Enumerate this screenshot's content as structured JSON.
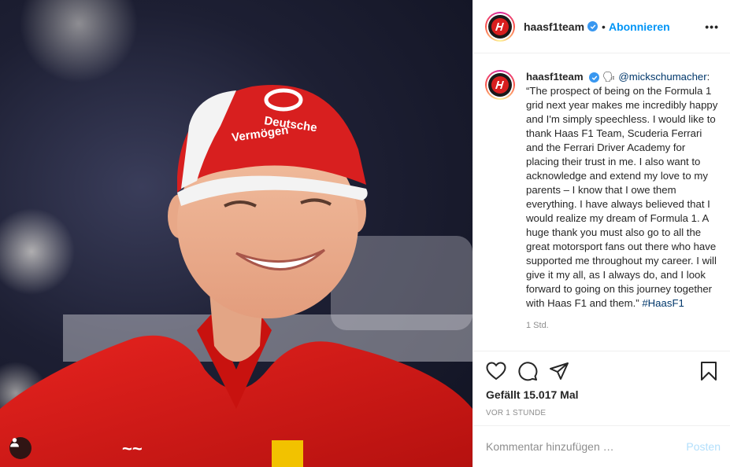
{
  "post": {
    "username": "haasf1team",
    "follow_label": "Abonnieren",
    "separator": "•",
    "more_label": "•••"
  },
  "caption": {
    "username": "haasf1team",
    "emoji": "🗣",
    "mention": "@mickschumacher",
    "text": ": “The prospect of being on the Formula 1 grid next year makes me incredibly happy and I'm simply speechless. I would like to thank Haas F1 Team, Scuderia Ferrari and the Ferrari Driver Academy for placing their trust in me. I also want to acknowledge and extend my love to my parents – I know that I owe them everything. I have always believed that I would realize my dream of Formula 1. A huge thank you must also go to all the great motorsport fans out there who have supported me throughout my career. I will give it my all, as I always do, and I look forward to going on this journey together with Haas F1 and them.” ",
    "hashtag": "#HaasF1",
    "time": "1 Std."
  },
  "actions": {
    "likes": "Gefällt 15.017 Mal",
    "posted": "VOR 1 STUNDE"
  },
  "comment": {
    "placeholder": "Kommentar hinzufügen …",
    "post_label": "Posten"
  },
  "photo": {
    "cap_text_1": "Deutsche",
    "cap_text_2": "Vermögen"
  },
  "colors": {
    "accent": "#0095f6",
    "verified": "#3897f0",
    "ferrari_red": "#d81f1f"
  }
}
